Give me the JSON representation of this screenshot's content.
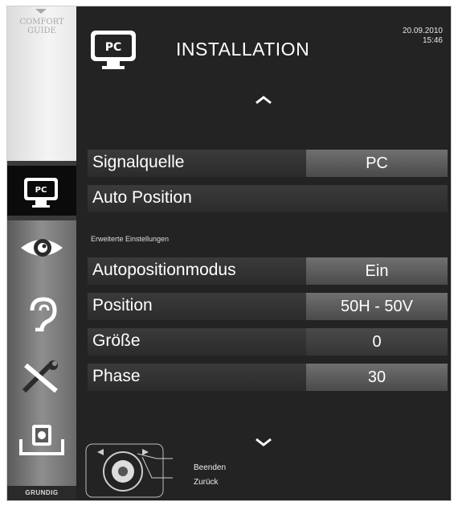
{
  "sidebar": {
    "comfort_guide": [
      "COMFORT",
      "GUIDE"
    ],
    "items": [
      {
        "icon": "pc-icon"
      },
      {
        "icon": "eye-icon"
      },
      {
        "icon": "ear-icon"
      },
      {
        "icon": "tools-icon"
      },
      {
        "icon": "source-icon"
      }
    ],
    "brand": "GRUNDIG"
  },
  "header": {
    "icon_label": "PC",
    "title": "INSTALLATION",
    "date": "20.09.2010",
    "time": "15:46"
  },
  "menu": {
    "signal_source": {
      "label": "Signalquelle",
      "value": "PC"
    },
    "auto_position": {
      "label": "Auto Position"
    },
    "section_title": "Erweiterte Einstellungen",
    "settings": [
      {
        "label": "Autopositionmodus",
        "value": "Ein"
      },
      {
        "label": "Position",
        "value": "50H - 50V"
      },
      {
        "label": "Größe",
        "value": "0"
      },
      {
        "label": "Phase",
        "value": "30"
      }
    ]
  },
  "legend": {
    "exit": "Beenden",
    "back": "Zurück"
  },
  "colors": {
    "background": "#232323",
    "value_cell": "#5c5c5c",
    "text": "#ffffff"
  }
}
